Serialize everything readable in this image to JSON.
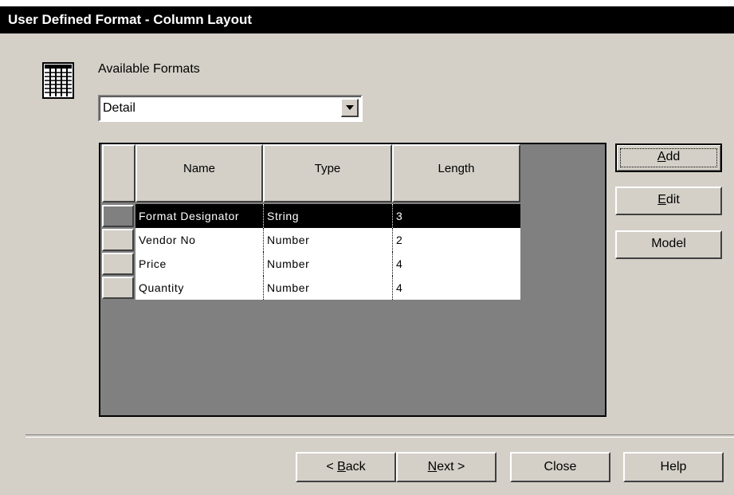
{
  "window": {
    "title": "User Defined Format - Column Layout"
  },
  "formats": {
    "label": "Available Formats",
    "selected": "Detail"
  },
  "grid": {
    "columns": [
      "Name",
      "Type",
      "Length"
    ],
    "rows": [
      {
        "name": "Format Designator",
        "type": "String",
        "length": "3",
        "selected": true
      },
      {
        "name": "Vendor No",
        "type": "Number",
        "length": "2",
        "selected": false
      },
      {
        "name": "Price",
        "type": "Number",
        "length": "4",
        "selected": false
      },
      {
        "name": "Quantity",
        "type": "Number",
        "length": "4",
        "selected": false
      }
    ]
  },
  "side_buttons": {
    "add_mnemonic": "A",
    "add_rest": "dd",
    "edit_mnemonic": "E",
    "edit_rest": "dit",
    "model": "Model"
  },
  "footer_buttons": {
    "back_prefix": "< ",
    "back_mnemonic": "B",
    "back_rest": "ack",
    "next_mnemonic": "N",
    "next_rest": "ext >",
    "close": "Close",
    "help": "Help"
  },
  "icons": {
    "format_icon": "column-layout-icon",
    "dropdown_icon": "chevron-down-icon"
  },
  "colors": {
    "titlebar": "#000000",
    "dialog_bg": "#d4d0c8",
    "grid_bg": "#808080",
    "selected_row": "#000000"
  }
}
